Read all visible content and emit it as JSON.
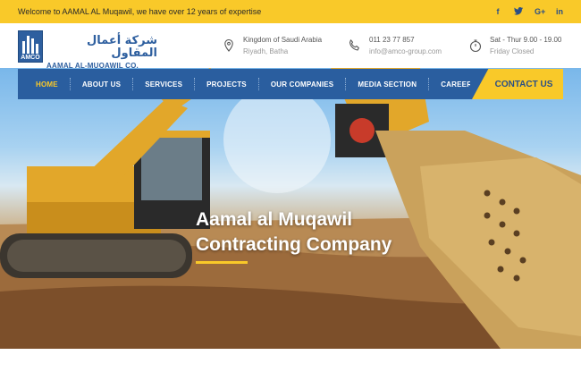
{
  "topbar": {
    "welcome_text": "Welcome to AAMAL AL Muqawil, we have over 12 years of expertise",
    "social": [
      {
        "icon": "facebook-icon",
        "glyph": "f"
      },
      {
        "icon": "twitter-icon",
        "glyph": "t"
      },
      {
        "icon": "google-plus-icon",
        "glyph": "G+"
      },
      {
        "icon": "linkedin-icon",
        "glyph": "in"
      }
    ]
  },
  "logo": {
    "arabic": "شركة أعمال المقاول",
    "english": "AAMAL AL-MUQAWIL CO.",
    "badge": "AMCO"
  },
  "contact_info": {
    "location": {
      "line1": "Kingdom of Saudi Arabia",
      "line2": "Riyadh, Batha"
    },
    "phone": {
      "line1": "011 23 77 857",
      "line2": "info@amco-group.com"
    },
    "hours": {
      "line1": "Sat - Thur 9.00 - 19.00",
      "line2": "Friday Closed"
    }
  },
  "nav": {
    "items": [
      "HOME",
      "ABOUT US",
      "SERVICES",
      "PROJECTS",
      "OUR COMPANIES",
      "MEDIA SECTION",
      "CAREERS"
    ],
    "active_index": 0,
    "contact_label": "CONTACT US"
  },
  "hero": {
    "title_line1": "Aamal al Muqawil",
    "title_line2": "Contracting Company"
  },
  "colors": {
    "accent_yellow": "#f9c929",
    "brand_blue": "#2a5e9f"
  }
}
